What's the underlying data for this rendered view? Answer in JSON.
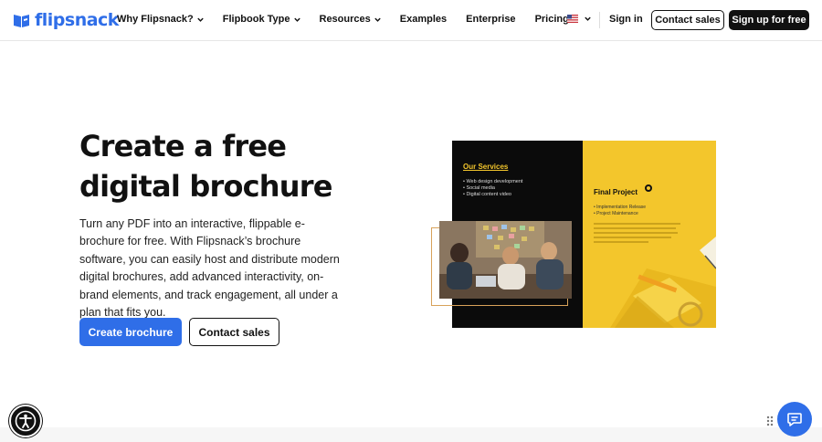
{
  "brand": {
    "name": "flipsnack",
    "accent": "#2f6ee8"
  },
  "nav": {
    "items": [
      {
        "label": "Why Flipsnack?",
        "dropdown": true
      },
      {
        "label": "Flipbook Type",
        "dropdown": true
      },
      {
        "label": "Resources",
        "dropdown": true
      },
      {
        "label": "Examples",
        "dropdown": false
      },
      {
        "label": "Enterprise",
        "dropdown": false
      },
      {
        "label": "Pricing",
        "dropdown": false
      }
    ],
    "language_icon": "us-flag-icon",
    "signin_label": "Sign in",
    "contact_label": "Contact sales",
    "signup_label": "Sign up for free"
  },
  "hero": {
    "title_line1": "Create a free",
    "title_line2": "digital brochure",
    "description": "Turn any PDF into an interactive, flippable e-brochure for free. With Flipsnack’s brochure software, you can easily host and distribute modern digital brochures, add advanced interactivity, on-brand elements, and track engagement, all under a plan that fits you.",
    "primary_cta": "Create brochure",
    "secondary_cta": "Contact sales"
  },
  "brochure": {
    "left_title": "Our Services",
    "left_items": [
      "• Web design development",
      "• Social media",
      "• Digital content video"
    ],
    "right_title": "Final Project",
    "right_items": [
      "• Implementation Release",
      "• Project Maintenance"
    ]
  },
  "floating": {
    "accessibility_icon": "accessibility-icon",
    "chat_icon": "chat-icon"
  }
}
